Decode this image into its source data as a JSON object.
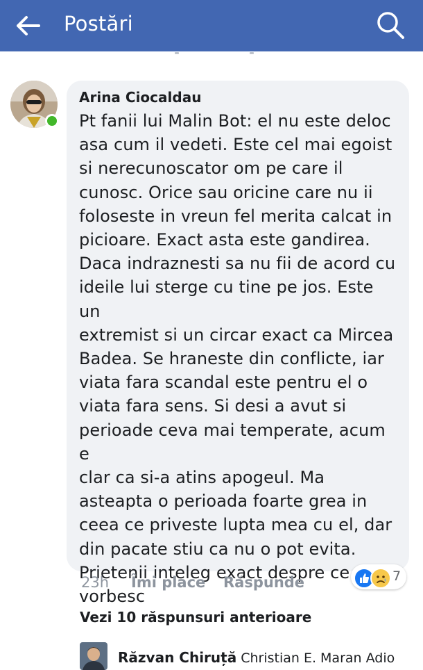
{
  "header": {
    "title": "Postări",
    "back_icon": "arrow-left-icon",
    "search_icon": "search-icon",
    "background_color": "#4267b2"
  },
  "comment": {
    "author": "Arina Ciocaldau",
    "online": true,
    "lines": [
      "Pt fanii lui Malin Bot: el nu este deloc",
      "asa cum il vedeti. Este cel mai egoist",
      "si nerecunoscator om pe care il",
      "cunosc. Orice sau oricine care nu ii",
      "foloseste in vreun fel merita calcat in",
      "picioare. Exact asta este gandirea.",
      "Daca indraznesti sa nu fii de acord cu",
      "ideile lui sterge cu tine pe jos. Este un",
      "extremist si un circar exact ca Mircea",
      "Badea. Se hraneste din conflicte, iar",
      "viata fara scandal este pentru el o",
      "viata fara sens. Si desi a avut si",
      "perioade ceva mai temperate, acum e",
      "clar ca si-a atins apogeul. Ma",
      "asteapta o perioada foarte grea in",
      "ceea ce priveste lupta mea cu el, dar",
      "din pacate stiu ca nu o pot evita.",
      "Prietenii inteleg exact despre ce",
      "vorbesc"
    ],
    "time": "23h",
    "like_label": "Îmi place",
    "reply_label": "Răspunde",
    "reactions": {
      "icons": [
        "like-reaction-icon",
        "sad-reaction-icon"
      ],
      "count": "7"
    }
  },
  "previous_replies_label": "Vezi 10 răspunsuri anterioare",
  "reply_preview": {
    "author": "Răzvan Chiruță",
    "text": "Christian E. Maran Adio"
  }
}
